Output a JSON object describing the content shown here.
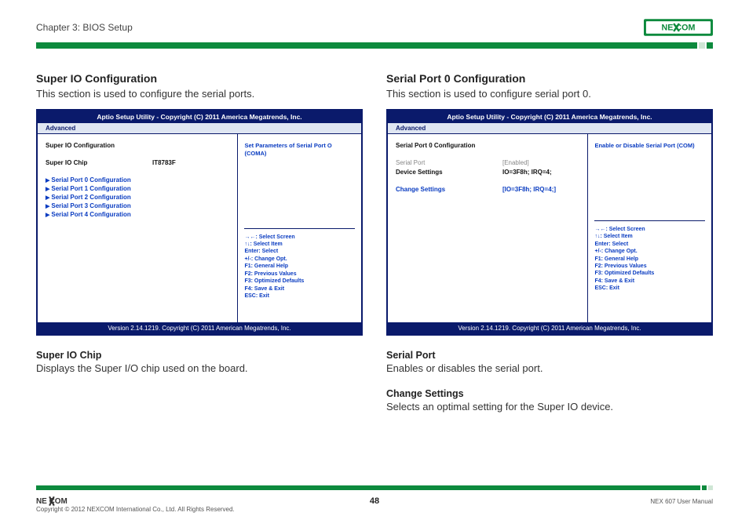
{
  "header": {
    "chapter": "Chapter 3: BIOS Setup",
    "logo_text": "NEXCOM"
  },
  "left": {
    "title": "Super IO Configuration",
    "intro": "This section is used to configure the serial ports.",
    "bios": {
      "header": "Aptio Setup Utility - Copyright (C) 2011 America Megatrends, Inc.",
      "tab": "Advanced",
      "section_title": "Super IO Configuration",
      "chip_label": "Super IO Chip",
      "chip_value": "IT8783F",
      "nav": [
        "Serial Port 0 Configuration",
        "Serial Port 1 Configuration",
        "Serial Port 2 Configuration",
        "Serial Port 3 Configuration",
        "Serial Port 4 Configuration"
      ],
      "help": "Set Parameters of Serial Port O (COMA)",
      "keys": {
        "k0": "→←: Select Screen",
        "k1": "↑↓: Select Item",
        "k2": "Enter: Select",
        "k3": "+/-: Change Opt.",
        "k4": "F1: General Help",
        "k5": "F2: Previous Values",
        "k6": "F3: Optimized Defaults",
        "k7": "F4: Save & Exit",
        "k8": "ESC: Exit"
      },
      "footer": "Version 2.14.1219. Copyright (C) 2011 American Megatrends, Inc."
    },
    "sub1_title": "Super IO Chip",
    "sub1_text": "Displays the Super I/O chip used on the board."
  },
  "right": {
    "title": "Serial Port 0 Configuration",
    "intro": "This section is used to configure serial port 0.",
    "bios": {
      "header": "Aptio Setup Utility - Copyright (C) 2011 America Megatrends, Inc.",
      "tab": "Advanced",
      "section_title": "Serial Port 0 Configuration",
      "row1_label": "Serial Port",
      "row1_value": "[Enabled]",
      "row2_label": "Device Settings",
      "row2_value": "IO=3F8h; IRQ=4;",
      "row3_label": "Change Settings",
      "row3_value": "[IO=3F8h; IRQ=4;]",
      "help": "Enable or Disable Serial Port (COM)",
      "keys": {
        "k0": "→←: Select Screen",
        "k1": "↑↓: Select Item",
        "k2": "Enter: Select",
        "k3": "+/-: Change Opt.",
        "k4": "F1: General Help",
        "k5": "F2: Previous Values",
        "k6": "F3: Optimized Defaults",
        "k7": "F4: Save & Exit",
        "k8": "ESC: Exit"
      },
      "footer": "Version 2.14.1219. Copyright (C) 2011 American Megatrends, Inc."
    },
    "sub1_title": "Serial Port",
    "sub1_text": "Enables or disables the serial port.",
    "sub2_title": "Change Settings",
    "sub2_text": "Selects an optimal setting for the Super IO device."
  },
  "footer": {
    "copyright": "Copyright © 2012 NEXCOM International Co., Ltd. All Rights Reserved.",
    "page": "48",
    "manual": "NEX 607 User Manual"
  }
}
